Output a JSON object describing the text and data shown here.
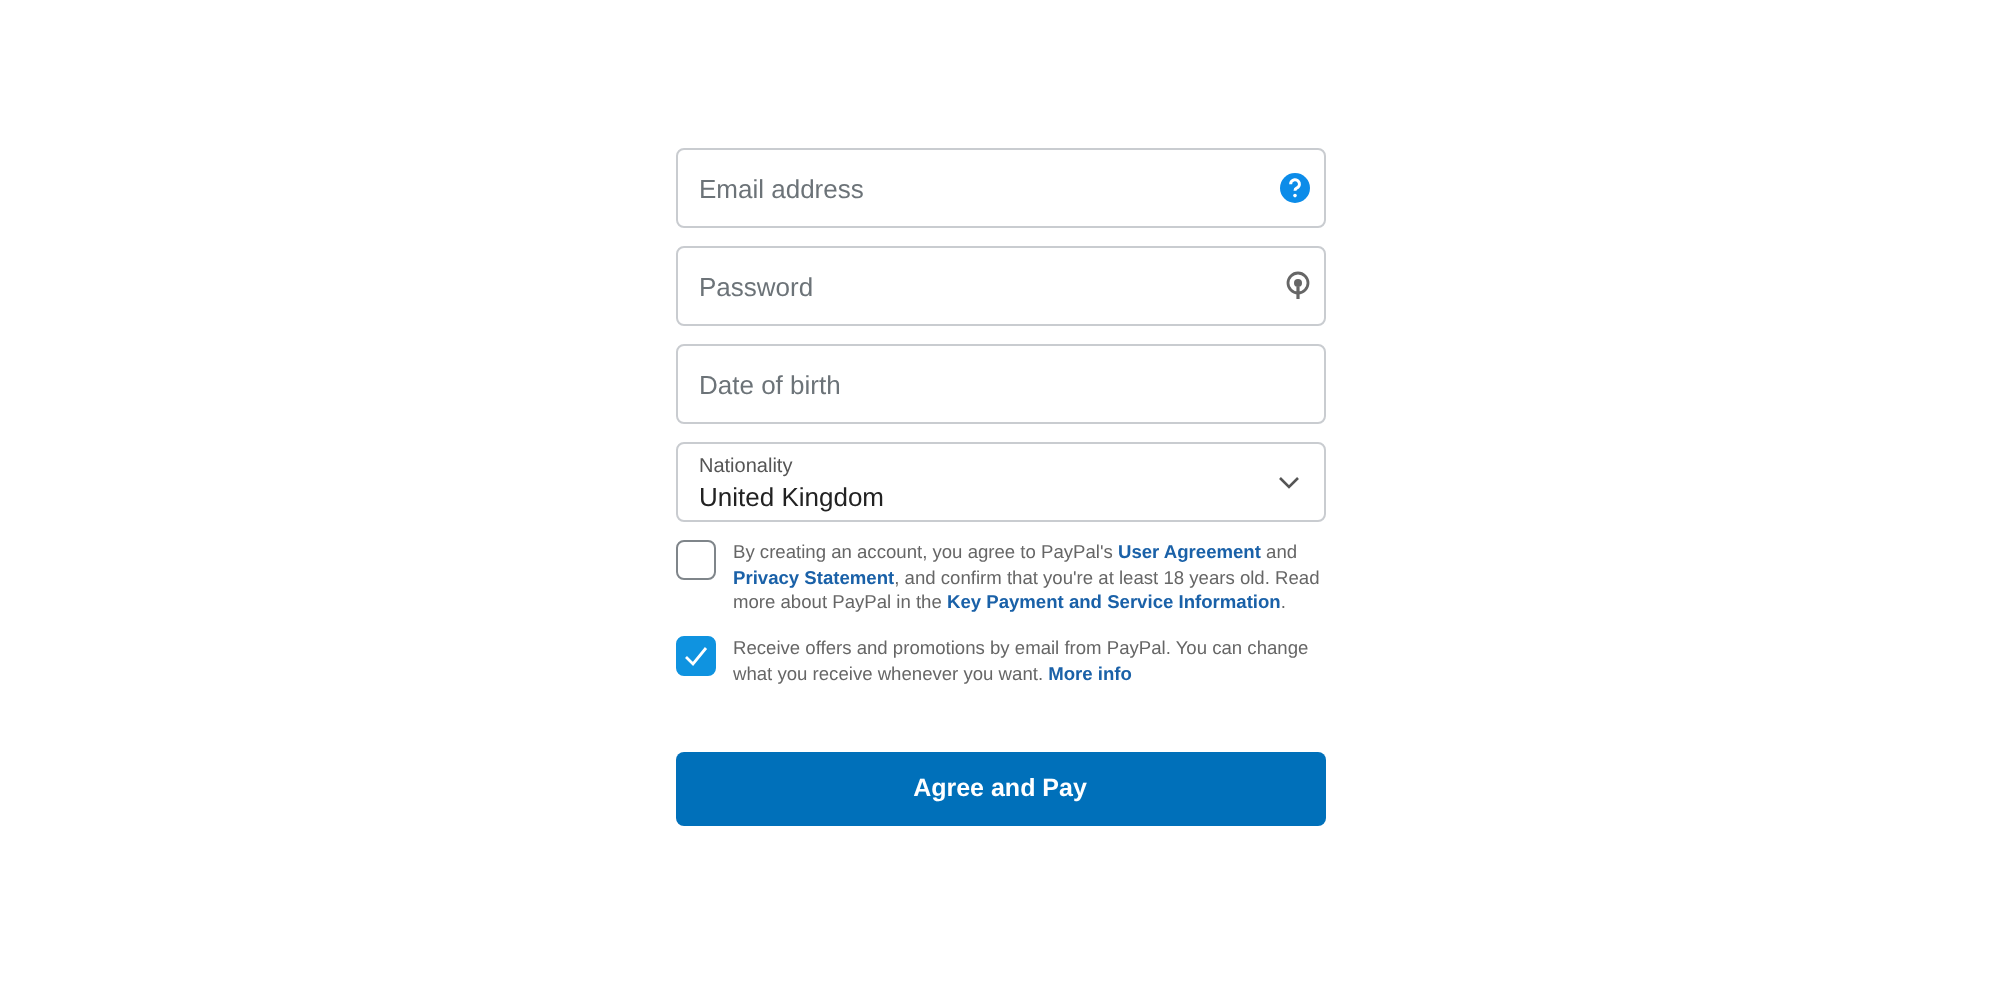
{
  "fields": [
    {
      "kind": "email",
      "placeholder": "Email address"
    },
    {
      "kind": "password",
      "placeholder": "Password"
    },
    {
      "kind": "date",
      "placeholder": "Date of birth"
    },
    {
      "kind": "select",
      "label": "Nationality",
      "value": "United Kingdom"
    }
  ],
  "consents": [
    {
      "checked": false,
      "parts": [
        {
          "kind": "text",
          "text": "By creating an account, you agree to PayPal's "
        },
        {
          "kind": "link",
          "text": "User Agreement"
        },
        {
          "kind": "text",
          "text": " and "
        },
        {
          "kind": "link",
          "text": "Privacy Statement"
        },
        {
          "kind": "text",
          "text": ", and confirm that you're at least 18 years old. Read more about PayPal in the "
        },
        {
          "kind": "link",
          "text": "Key Payment and Service Information"
        },
        {
          "kind": "text",
          "text": "."
        }
      ]
    },
    {
      "checked": true,
      "parts": [
        {
          "kind": "text",
          "text": "Receive offers and promotions by email from PayPal. You can change what you receive whenever you want. "
        },
        {
          "kind": "link",
          "text": "More info"
        }
      ]
    }
  ],
  "submit": {
    "label": "Agree and Pay"
  }
}
